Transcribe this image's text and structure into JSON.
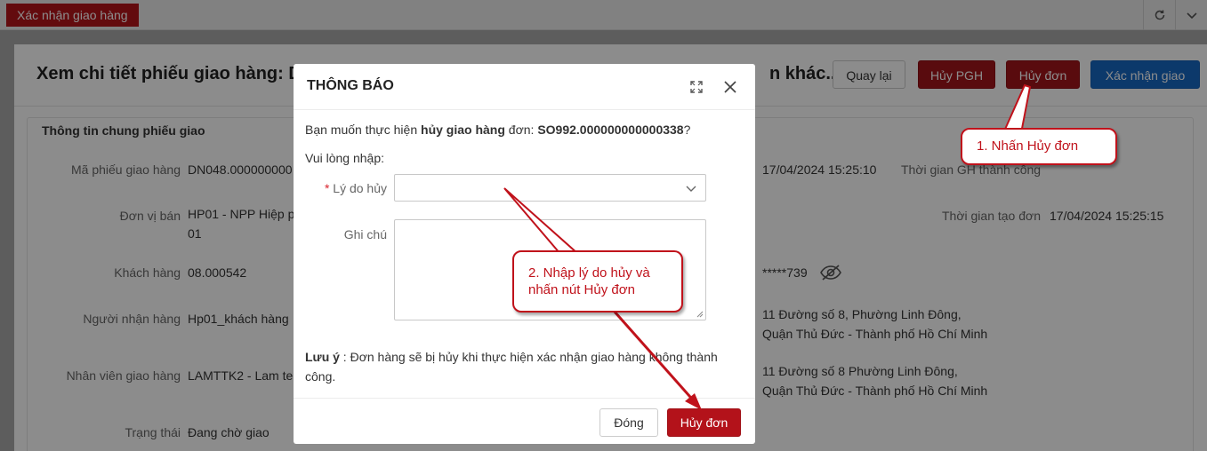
{
  "topbar": {
    "active_tab": "Xác nhận giao hàng"
  },
  "page": {
    "title": "Xem chi tiết phiếu giao hàng: D",
    "title_tail": "n khác...",
    "buttons": {
      "back": "Quay lại",
      "cancel_pgh": "Hủy PGH",
      "cancel_order": "Hủy đơn",
      "confirm": "Xác nhận giao"
    },
    "section_title": "Thông tin chung phiếu giao",
    "fields": [
      {
        "label": "Mã phiếu giao hàng",
        "value": "DN048.000000000"
      },
      {
        "label": "Đơn vị bán",
        "value": "HP01 - NPP Hiệp p",
        "value2": "01"
      },
      {
        "label": "Khách hàng",
        "value": "08.000542"
      },
      {
        "label": "Người nhận hàng",
        "value": "Hp01_khách hàng"
      },
      {
        "label": "Nhân viên giao hàng",
        "value": "LAMTTK2 - Lam te"
      },
      {
        "label": "Trạng thái",
        "value": "Đang chờ giao"
      }
    ],
    "right_fields": {
      "date1": "17/04/2024 15:25:10",
      "label_gh": "Thời gian GH thành công",
      "label_created": "Thời gian tạo đơn",
      "created": "17/04/2024 15:25:15",
      "phone_masked": "*****739",
      "address1_line1": "11 Đường số 8, Phường Linh Đông,",
      "address1_line2": "Quận Thủ Đức - Thành phố Hồ Chí Minh",
      "address2_line1": "11 Đường số 8 Phường Linh Đông,",
      "address2_line2": "Quận Thủ Đức - Thành phố Hồ Chí Minh"
    }
  },
  "modal": {
    "title": "THÔNG BÁO",
    "question_prefix": "Bạn muốn thực hiện ",
    "question_action": "hủy giao hàng",
    "question_mid": " đơn: ",
    "question_order": "SO992.000000000000338",
    "question_suffix": "?",
    "please_enter": "Vui lòng nhập:",
    "reason_required_mark": "*",
    "reason_label": "Lý do hủy",
    "note_label": "Ghi chú",
    "notice_bold": "Lưu ý",
    "notice_text": " : Đơn hàng sẽ bị hủy khi thực hiện xác nhận giao hàng không thành",
    "notice_text2": "công.",
    "close_button": "Đóng",
    "cancel_button": "Hủy đơn"
  },
  "annotations": {
    "step1": "1. Nhấn Hủy đơn",
    "step2_line1": "2. Nhập lý do hủy và",
    "step2_line2": "nhấn nút Hủy đơn"
  },
  "colors": {
    "primary_red": "#b3121a",
    "blue": "#1768c4",
    "callout_red": "#c0121b"
  }
}
